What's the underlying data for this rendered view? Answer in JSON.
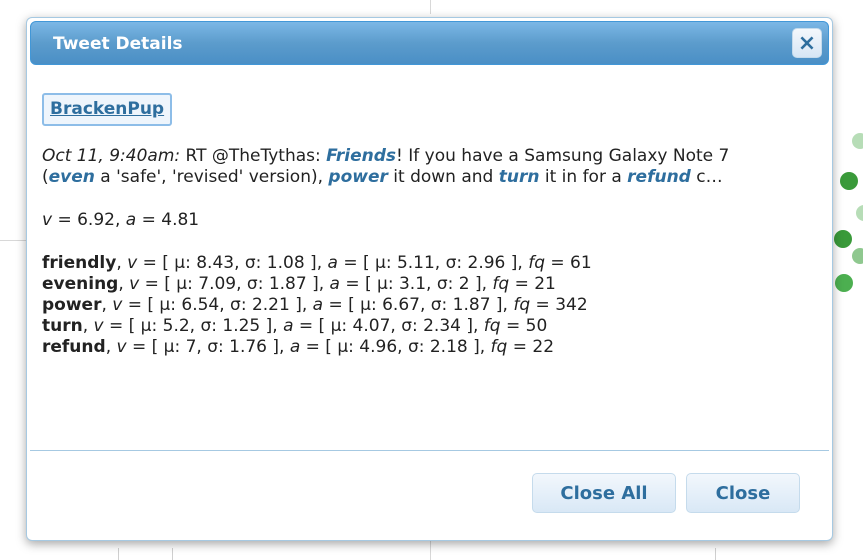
{
  "dialog": {
    "title": "Tweet Details",
    "close_icon": "×"
  },
  "tweet": {
    "user": "BrackenPup",
    "date": "Oct 11, 9:40am:",
    "t1": " RT @TheTythas: ",
    "k1": "Friends",
    "t2": "! If you have a Samsung Galaxy Note 7 (",
    "k2": "even",
    "t3": " a 'safe', 'revised' version), ",
    "k3": "power",
    "t4": " it down and ",
    "k4": "turn",
    "t5": " it in for a ",
    "k5": "refund",
    "t6": " c…"
  },
  "summary": {
    "v_label": "v",
    "v_value": " = 6.92, ",
    "a_label": "a",
    "a_value": " = 4.81"
  },
  "stats": [
    {
      "word": "friendly",
      "v": ", v = [ μ: 8.43, σ: 1.08 ], ",
      "a": "a = [ μ: 5.11, σ: 2.96 ], ",
      "fq": "fq = 61"
    },
    {
      "word": "evening",
      "v": ", v = [ μ: 7.09, σ: 1.87 ], ",
      "a": "a = [ μ: 3.1, σ: 2 ], ",
      "fq": "fq = 21"
    },
    {
      "word": "power",
      "v": ", v = [ μ: 6.54, σ: 2.21 ], ",
      "a": "a = [ μ: 6.67, σ: 1.87 ], ",
      "fq": "fq = 342"
    },
    {
      "word": "turn",
      "v": ", v = [ μ: 5.2, σ: 1.25 ], ",
      "a": "a = [ μ: 4.07, σ: 2.34 ], ",
      "fq": "fq = 50"
    },
    {
      "word": "refund",
      "v": ", v = [ μ: 7, σ: 1.76 ], ",
      "a": "a = [ μ: 4.96, σ: 2.18 ], ",
      "fq": "fq = 22"
    }
  ],
  "buttons": {
    "close_all": "Close All",
    "close": "Close"
  },
  "colors": {
    "accent": "#2e6e9e",
    "titlebar": "#5c9ccc",
    "border": "#a6c9e2",
    "dots": [
      "#8fc88f",
      "#3a9a3a",
      "#b7ddb7"
    ]
  }
}
